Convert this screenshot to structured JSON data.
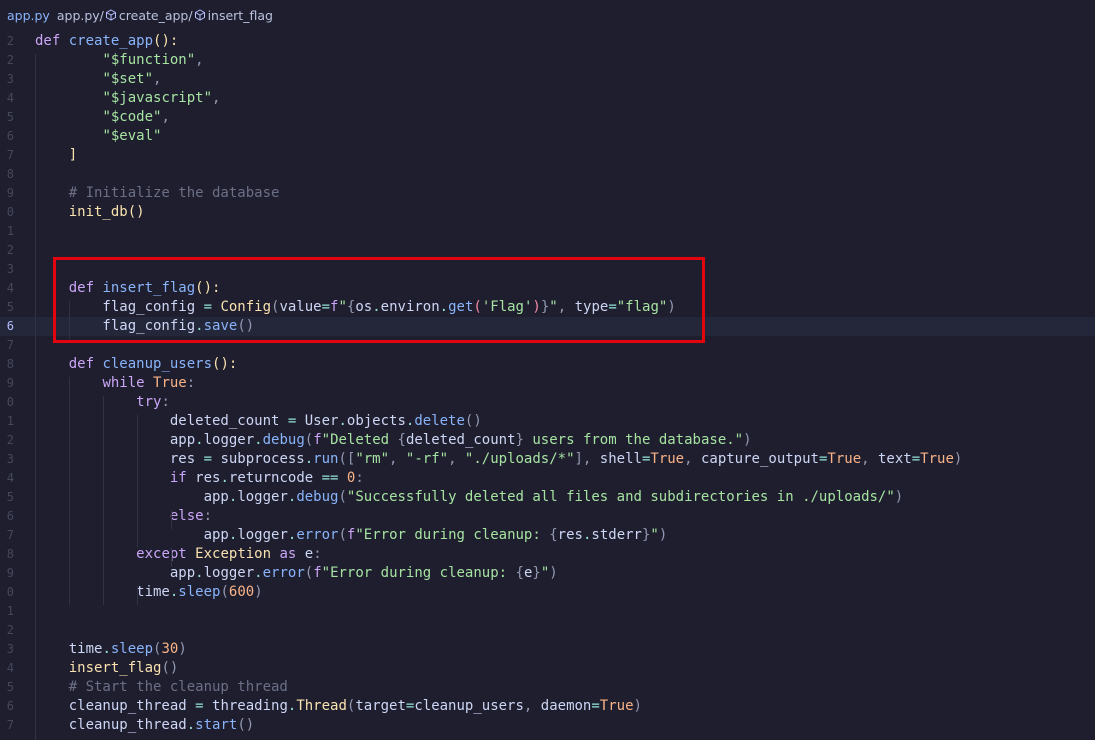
{
  "breadcrumb": {
    "file": "app.py",
    "segments": [
      "app.py/",
      "create_app/",
      "insert_flag"
    ]
  },
  "icons": {
    "symbol": "cube-symbol-icon"
  },
  "editor": {
    "lines": [
      {
        "num": "2",
        "tokens": [
          [
            "k",
            "def "
          ],
          [
            "f",
            "create_app"
          ],
          [
            "y",
            "():"
          ]
        ]
      },
      {
        "num": "2",
        "tokens": [
          [
            "t",
            "        "
          ],
          [
            "s",
            "\"$function\""
          ],
          [
            "p",
            ","
          ]
        ]
      },
      {
        "num": "3",
        "tokens": [
          [
            "t",
            "        "
          ],
          [
            "s",
            "\"$set\""
          ],
          [
            "p",
            ","
          ]
        ]
      },
      {
        "num": "4",
        "tokens": [
          [
            "t",
            "        "
          ],
          [
            "s",
            "\"$javascript\""
          ],
          [
            "p",
            ","
          ]
        ]
      },
      {
        "num": "5",
        "tokens": [
          [
            "t",
            "        "
          ],
          [
            "s",
            "\"$code\""
          ],
          [
            "p",
            ","
          ]
        ]
      },
      {
        "num": "6",
        "tokens": [
          [
            "t",
            "        "
          ],
          [
            "s",
            "\"$eval\""
          ]
        ]
      },
      {
        "num": "7",
        "tokens": [
          [
            "t",
            "    "
          ],
          [
            "y",
            "]"
          ]
        ]
      },
      {
        "num": "8",
        "tokens": []
      },
      {
        "num": "9",
        "tokens": [
          [
            "t",
            "    "
          ],
          [
            "c",
            "# Initialize the database"
          ]
        ]
      },
      {
        "num": "0",
        "tokens": [
          [
            "t",
            "    "
          ],
          [
            "y",
            "init_db"
          ],
          [
            "y",
            "()"
          ]
        ]
      },
      {
        "num": "1",
        "tokens": []
      },
      {
        "num": "2",
        "tokens": []
      },
      {
        "num": "3",
        "tokens": []
      },
      {
        "num": "4",
        "tokens": [
          [
            "t",
            "    "
          ],
          [
            "k",
            "def "
          ],
          [
            "f",
            "insert_flag"
          ],
          [
            "y",
            "():"
          ]
        ]
      },
      {
        "num": "5",
        "tokens": [
          [
            "t",
            "        flag_config "
          ],
          [
            "o",
            "= "
          ],
          [
            "y",
            "Config"
          ],
          [
            "p",
            "("
          ],
          [
            "t",
            "value"
          ],
          [
            "o",
            "="
          ],
          [
            "k",
            "f"
          ],
          [
            "s",
            "\""
          ],
          [
            "p",
            "{"
          ],
          [
            "t",
            "os"
          ],
          [
            "o",
            "."
          ],
          [
            "t",
            "environ"
          ],
          [
            "o",
            "."
          ],
          [
            "f",
            "get"
          ],
          [
            "pa",
            "("
          ],
          [
            "s",
            "'Flag'"
          ],
          [
            "pa",
            ")"
          ],
          [
            "p",
            "}"
          ],
          [
            "s",
            "\""
          ],
          [
            "p",
            ", "
          ],
          [
            "t",
            "type"
          ],
          [
            "o",
            "="
          ],
          [
            "s",
            "\"flag\""
          ],
          [
            "p",
            ")"
          ]
        ]
      },
      {
        "num": "6",
        "tokens": [
          [
            "t",
            "        flag_config"
          ],
          [
            "o",
            "."
          ],
          [
            "f",
            "save"
          ],
          [
            "p",
            "()"
          ]
        ],
        "current": true
      },
      {
        "num": "7",
        "tokens": []
      },
      {
        "num": "8",
        "tokens": [
          [
            "t",
            "    "
          ],
          [
            "k",
            "def "
          ],
          [
            "f",
            "cleanup_users"
          ],
          [
            "y",
            "():"
          ]
        ]
      },
      {
        "num": "9",
        "tokens": [
          [
            "t",
            "        "
          ],
          [
            "k",
            "while "
          ],
          [
            "n",
            "True"
          ],
          [
            "p",
            ":"
          ]
        ]
      },
      {
        "num": "0",
        "tokens": [
          [
            "t",
            "            "
          ],
          [
            "k",
            "try"
          ],
          [
            "p",
            ":"
          ]
        ]
      },
      {
        "num": "1",
        "tokens": [
          [
            "t",
            "                deleted_count "
          ],
          [
            "o",
            "= "
          ],
          [
            "t",
            "User"
          ],
          [
            "o",
            "."
          ],
          [
            "t",
            "objects"
          ],
          [
            "o",
            "."
          ],
          [
            "f",
            "delete"
          ],
          [
            "p",
            "()"
          ]
        ]
      },
      {
        "num": "2",
        "tokens": [
          [
            "t",
            "                app"
          ],
          [
            "o",
            "."
          ],
          [
            "t",
            "logger"
          ],
          [
            "o",
            "."
          ],
          [
            "f",
            "debug"
          ],
          [
            "p",
            "("
          ],
          [
            "k",
            "f"
          ],
          [
            "s",
            "\"Deleted "
          ],
          [
            "p",
            "{"
          ],
          [
            "t",
            "deleted_count"
          ],
          [
            "p",
            "}"
          ],
          [
            "s",
            " users from the database.\""
          ],
          [
            "p",
            ")"
          ]
        ]
      },
      {
        "num": "3",
        "tokens": [
          [
            "t",
            "                res "
          ],
          [
            "o",
            "= "
          ],
          [
            "t",
            "subprocess"
          ],
          [
            "o",
            "."
          ],
          [
            "f",
            "run"
          ],
          [
            "p",
            "(["
          ],
          [
            "s",
            "\"rm\""
          ],
          [
            "p",
            ", "
          ],
          [
            "s",
            "\"-rf\""
          ],
          [
            "p",
            ", "
          ],
          [
            "s",
            "\"./uploads/*\""
          ],
          [
            "p",
            "], "
          ],
          [
            "t",
            "shell"
          ],
          [
            "o",
            "="
          ],
          [
            "n",
            "True"
          ],
          [
            "p",
            ", "
          ],
          [
            "t",
            "capture_output"
          ],
          [
            "o",
            "="
          ],
          [
            "n",
            "True"
          ],
          [
            "p",
            ", "
          ],
          [
            "t",
            "text"
          ],
          [
            "o",
            "="
          ],
          [
            "n",
            "True"
          ],
          [
            "p",
            ")"
          ]
        ]
      },
      {
        "num": "4",
        "tokens": [
          [
            "t",
            "                "
          ],
          [
            "k",
            "if "
          ],
          [
            "t",
            "res"
          ],
          [
            "o",
            "."
          ],
          [
            "t",
            "returncode "
          ],
          [
            "o",
            "== "
          ],
          [
            "n",
            "0"
          ],
          [
            "p",
            ":"
          ]
        ]
      },
      {
        "num": "5",
        "tokens": [
          [
            "t",
            "                    app"
          ],
          [
            "o",
            "."
          ],
          [
            "t",
            "logger"
          ],
          [
            "o",
            "."
          ],
          [
            "f",
            "debug"
          ],
          [
            "p",
            "("
          ],
          [
            "s",
            "\"Successfully deleted all files and subdirectories in ./uploads/\""
          ],
          [
            "p",
            ")"
          ]
        ]
      },
      {
        "num": "6",
        "tokens": [
          [
            "t",
            "                "
          ],
          [
            "k",
            "else"
          ],
          [
            "p",
            ":"
          ]
        ]
      },
      {
        "num": "7",
        "tokens": [
          [
            "t",
            "                    app"
          ],
          [
            "o",
            "."
          ],
          [
            "t",
            "logger"
          ],
          [
            "o",
            "."
          ],
          [
            "f",
            "error"
          ],
          [
            "p",
            "("
          ],
          [
            "k",
            "f"
          ],
          [
            "s",
            "\"Error during cleanup: "
          ],
          [
            "p",
            "{"
          ],
          [
            "t",
            "res"
          ],
          [
            "o",
            "."
          ],
          [
            "t",
            "stderr"
          ],
          [
            "p",
            "}"
          ],
          [
            "s",
            "\""
          ],
          [
            "p",
            ")"
          ]
        ]
      },
      {
        "num": "8",
        "tokens": [
          [
            "t",
            "            "
          ],
          [
            "k",
            "except "
          ],
          [
            "y",
            "Exception "
          ],
          [
            "k",
            "as "
          ],
          [
            "t",
            "e"
          ],
          [
            "p",
            ":"
          ]
        ]
      },
      {
        "num": "9",
        "tokens": [
          [
            "t",
            "                app"
          ],
          [
            "o",
            "."
          ],
          [
            "t",
            "logger"
          ],
          [
            "o",
            "."
          ],
          [
            "f",
            "error"
          ],
          [
            "p",
            "("
          ],
          [
            "k",
            "f"
          ],
          [
            "s",
            "\"Error during cleanup: "
          ],
          [
            "p",
            "{"
          ],
          [
            "t",
            "e"
          ],
          [
            "p",
            "}"
          ],
          [
            "s",
            "\""
          ],
          [
            "p",
            ")"
          ]
        ]
      },
      {
        "num": "0",
        "tokens": [
          [
            "t",
            "            time"
          ],
          [
            "o",
            "."
          ],
          [
            "f",
            "sleep"
          ],
          [
            "p",
            "("
          ],
          [
            "n",
            "600"
          ],
          [
            "p",
            ")"
          ]
        ]
      },
      {
        "num": "1",
        "tokens": []
      },
      {
        "num": "2",
        "tokens": []
      },
      {
        "num": "3",
        "tokens": [
          [
            "t",
            "    time"
          ],
          [
            "o",
            "."
          ],
          [
            "f",
            "sleep"
          ],
          [
            "p",
            "("
          ],
          [
            "n",
            "30"
          ],
          [
            "p",
            ")"
          ]
        ]
      },
      {
        "num": "4",
        "tokens": [
          [
            "t",
            "    "
          ],
          [
            "y",
            "insert_flag"
          ],
          [
            "p",
            "()"
          ]
        ]
      },
      {
        "num": "5",
        "tokens": [
          [
            "t",
            "    "
          ],
          [
            "c",
            "# Start the cleanup thread"
          ]
        ]
      },
      {
        "num": "6",
        "tokens": [
          [
            "t",
            "    cleanup_thread "
          ],
          [
            "o",
            "= "
          ],
          [
            "t",
            "threading"
          ],
          [
            "o",
            "."
          ],
          [
            "y",
            "Thread"
          ],
          [
            "p",
            "("
          ],
          [
            "t",
            "target"
          ],
          [
            "o",
            "="
          ],
          [
            "t",
            "cleanup_users"
          ],
          [
            "p",
            ", "
          ],
          [
            "t",
            "daemon"
          ],
          [
            "o",
            "="
          ],
          [
            "n",
            "True"
          ],
          [
            "p",
            ")"
          ]
        ]
      },
      {
        "num": "7",
        "tokens": [
          [
            "t",
            "    cleanup_thread"
          ],
          [
            "o",
            "."
          ],
          [
            "f",
            "start"
          ],
          [
            "p",
            "()"
          ]
        ]
      }
    ]
  }
}
